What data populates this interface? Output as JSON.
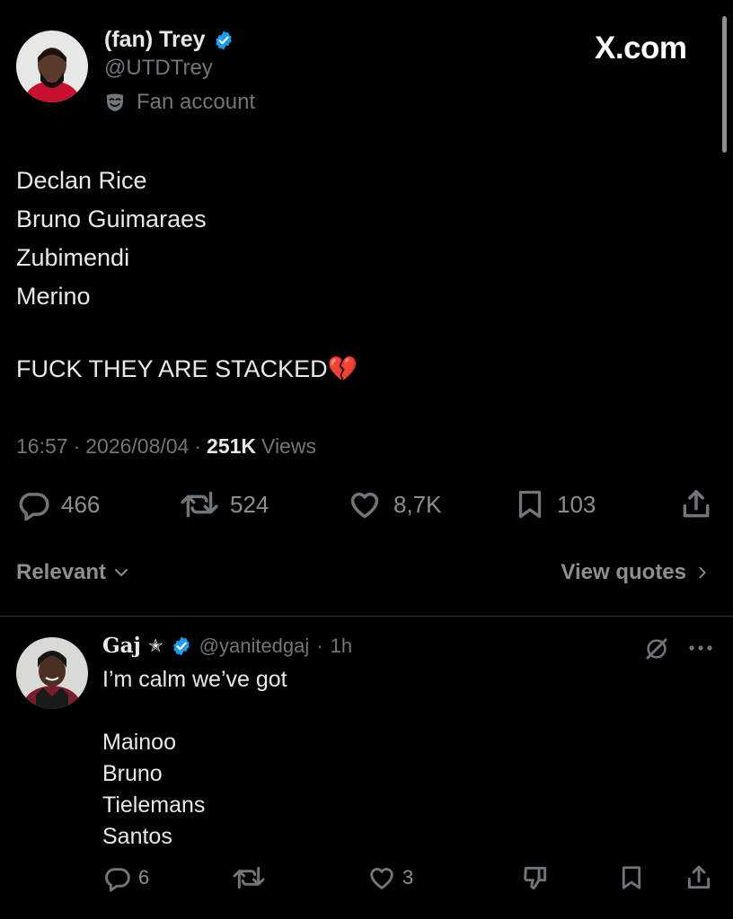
{
  "main_tweet": {
    "display_name": "(fan) Trey",
    "handle": "@UTDTrey",
    "label": "Fan account",
    "brand": "X.com",
    "body_lines": [
      "Declan Rice",
      "Bruno Guimaraes",
      "Zubimendi",
      "Merino"
    ],
    "shout": "FUCK THEY ARE STACKED",
    "shout_emoji": "💔",
    "time": "16:57",
    "date": "2026/08/04",
    "views_count": "251K",
    "views_label": "Views",
    "replies": "466",
    "reposts": "524",
    "likes": "8,7K",
    "bookmarks": "103"
  },
  "sort": {
    "relevant_label": "Relevant",
    "view_quotes_label": "View quotes"
  },
  "reply": {
    "display_name": "Gaj",
    "star": "✭",
    "handle": "@yanitedgaj",
    "time": "1h",
    "line1": "I’m calm we’ve got",
    "list": [
      "Mainoo",
      "Bruno",
      "Tielemans",
      "Santos"
    ],
    "replies": "6",
    "likes": "3"
  },
  "colors": {
    "background": "#000000",
    "text": "#e7e9ea",
    "muted": "#71767b",
    "verified": "#1d9bf0",
    "divider": "#2f3336"
  }
}
